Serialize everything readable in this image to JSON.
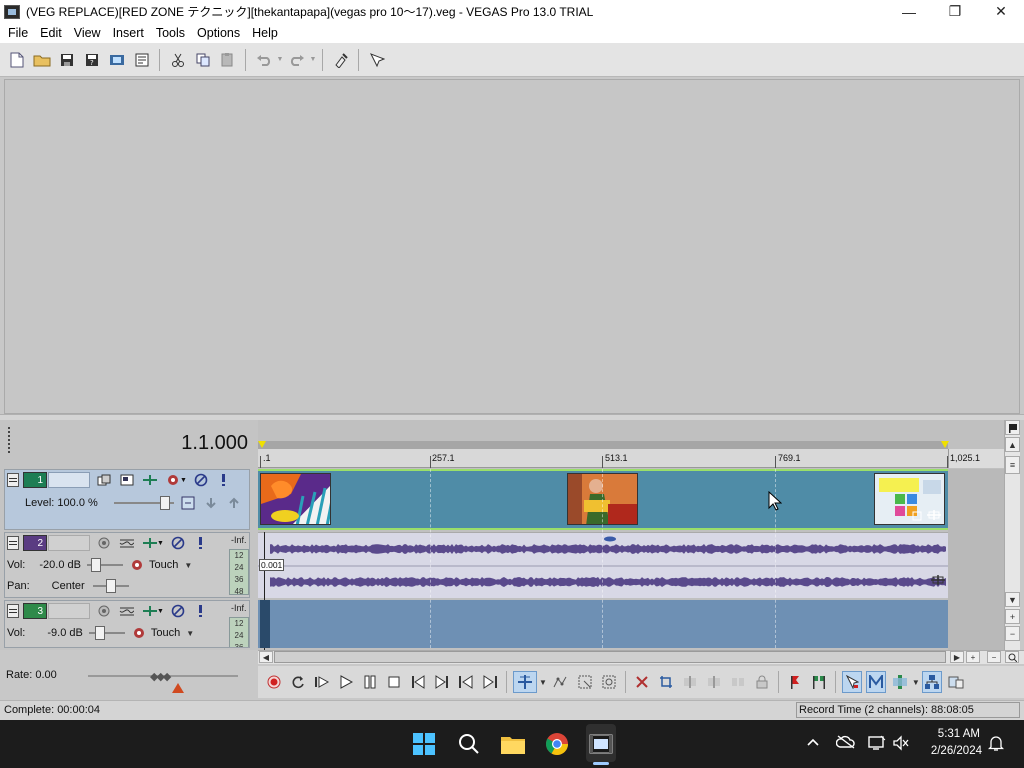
{
  "window": {
    "title": "(VEG REPLACE)[RED ZONE テクニック][thekantapapa](vegas pro 10〜17).veg - VEGAS Pro 13.0 TRIAL",
    "minimize": "—",
    "maximize": "❐",
    "close": "✕"
  },
  "menu": [
    "File",
    "Edit",
    "View",
    "Insert",
    "Tools",
    "Options",
    "Help"
  ],
  "timeline": {
    "timecode": "1.1.000",
    "ruler_labels": [
      ".1",
      "257.1",
      "513.1",
      "769.1",
      "1,025.1"
    ],
    "offset_label": "0.001"
  },
  "tracks": {
    "video": {
      "number": "1",
      "level_label": "Level: 100.0 %",
      "level": 1.0
    },
    "audio1": {
      "number": "2",
      "vol_label": "Vol:",
      "vol_value": "-20.0 dB",
      "pan_label": "Pan:",
      "pan_value": "Center",
      "mode": "Touch",
      "meter_inf": "-Inf.",
      "meter_ticks": [
        "12",
        "24",
        "36",
        "48"
      ]
    },
    "audio2": {
      "number": "3",
      "vol_label": "Vol:",
      "vol_value": "-9.0 dB",
      "mode": "Touch",
      "meter_inf": "-Inf.",
      "meter_ticks": [
        "12",
        "24",
        "36"
      ]
    }
  },
  "rate": {
    "label": "Rate: 0.00"
  },
  "status": {
    "left": "Complete: 00:00:04",
    "right": "Record Time (2 channels): 88:08:05"
  },
  "taskbar": {
    "time": "5:31 AM",
    "date": "2/26/2024"
  },
  "colors": {
    "video_lane": "#4f8ca7",
    "audio_lane": "#d8d8e6",
    "waveform": "#5a4a8c",
    "selection_edge": "#9adf6a",
    "taskbar": "#1c1c1c"
  }
}
